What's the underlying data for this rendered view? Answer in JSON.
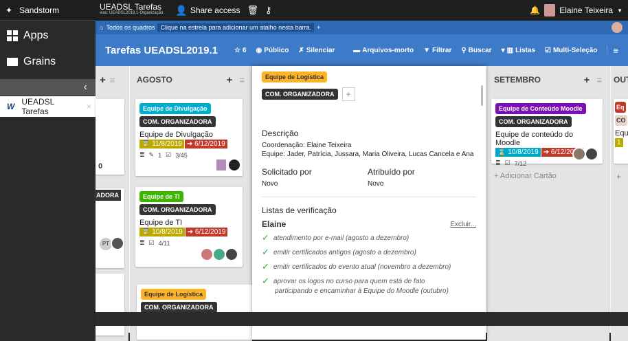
{
  "sidebar": {
    "title": "Sandstorm",
    "apps_label": "Apps",
    "grains_label": "Grains",
    "collapse_glyph": "‹",
    "grain_item": {
      "label": "UEADSL Tarefas",
      "close": "×"
    }
  },
  "topbar": {
    "app_title": "UEADSL Tarefas",
    "app_subtitle": "was: UEADSL2019.1-Organização",
    "share_label": "Share access",
    "user_name": "Elaine Teixeira"
  },
  "breadcrumb": {
    "all_boards": "Todos os quadros",
    "hint": "Clique na estrela para adicionar um atalho nesta barra.",
    "plus": "+"
  },
  "board": {
    "title": "Tarefas UEADSL2019.1",
    "stars": "6",
    "visibility": "Público",
    "mute": "Silenciar",
    "archives": "Arquivos-morto",
    "filter": "Filtrar",
    "search": "Buscar",
    "lists": "Listas",
    "multiselect": "Multi-Seleção"
  },
  "lists": [
    {
      "name": "AGOSTO",
      "plus": "+",
      "menu": "≡"
    },
    {
      "name": "SETEMBRO",
      "plus": "+",
      "menu": "≡"
    },
    {
      "name": "OUT",
      "plus": "",
      "menu": ""
    }
  ],
  "partial_left": {
    "number": "0",
    "label": "ADORA",
    "initials": "PT"
  },
  "cards": {
    "c1": {
      "label1": "Equipe de Divulgação",
      "label2": "COM. ORGANIZADORA",
      "title": "Equipe de Divulgação",
      "start": "11/8/2019",
      "due": "6/12/2019",
      "attach": "1",
      "checks": "3/45"
    },
    "c2": {
      "label1": "Equipe de TI",
      "label2": "COM. ORGANIZADORA",
      "title": "Equipe de TI",
      "start": "10/8/2019",
      "due": "6/12/2019",
      "checks": "4/11"
    },
    "c3": {
      "label1": "Equipe de Logística",
      "label2": "COM. ORGANIZADORA"
    },
    "c4": {
      "label1": "Equipe de Conteúdo Moodle",
      "label2": "COM. ORGANIZADORA",
      "title": "Equipe de conteúdo do Moodle",
      "start": "10/8/2019",
      "due": "6/12/2019",
      "checks": "7/12"
    },
    "c5": {
      "label1": "Eq",
      "label2": "CO",
      "title": "Equ",
      "start": "1"
    }
  },
  "add_card": "+ Adicionar Cartão",
  "add_card_partial": "+",
  "detail": {
    "label_orange": "Equipe de Logística",
    "label_dark": "COM. ORGANIZADORA",
    "add_label": "+",
    "desc_title": "Descrição",
    "desc_line1": "Coordenação: Elaine Teixeira",
    "desc_line2": "Equipe: Jader, Patrícia, Jussara, Maria Oliveira, Lucas Cancela e Ana",
    "requested_by_label": "Solicitado por",
    "requested_by_value": "Novo",
    "assigned_by_label": "Atribuído por",
    "assigned_by_value": "Novo",
    "checklists_title": "Listas de verificação",
    "checklist_name": "Elaine",
    "delete": "Excluir...",
    "items": [
      "atendimento por e-mail (agosto a dezembro)",
      "emitir certificados antigos (agosto a dezembro)",
      "emitir certificados do evento atual (novembro a dezembro)",
      "aprovar os logos no curso para quem está de fato"
    ],
    "item_cut": "participando e encaminhar à Equipe do Moodle (outubro)"
  }
}
